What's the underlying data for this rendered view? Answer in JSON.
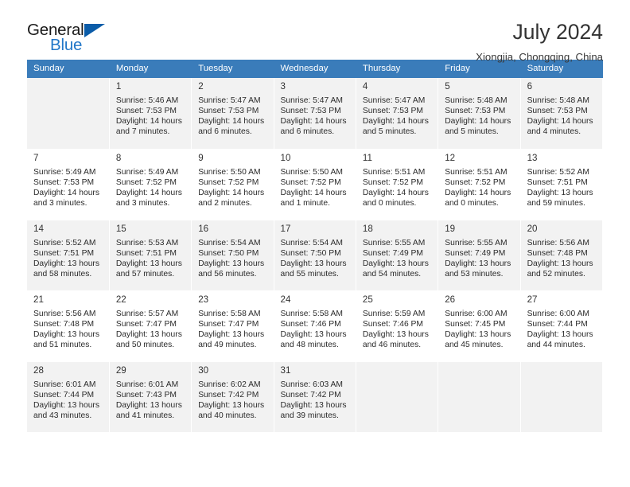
{
  "brand": {
    "name_dark": "General",
    "name_blue": "Blue",
    "accent_color": "#2277c8",
    "triangle_color": "#0b5ca8"
  },
  "header": {
    "title": "July 2024",
    "subtitle": "Xiongjia, Chongqing, China",
    "header_bg_color": "#3a7cba"
  },
  "labels": {
    "sunrise_prefix": "Sunrise:",
    "sunset_prefix": "Sunset:",
    "daylight_prefix": "Daylight:"
  },
  "weekdays": [
    "Sunday",
    "Monday",
    "Tuesday",
    "Wednesday",
    "Thursday",
    "Friday",
    "Saturday"
  ],
  "weeks": [
    [
      {
        "day": ""
      },
      {
        "day": "1",
        "sunrise": "Sunrise: 5:46 AM",
        "sunset": "Sunset: 7:53 PM",
        "daylight_line1": "Daylight: 14 hours",
        "daylight_line2": "and 7 minutes."
      },
      {
        "day": "2",
        "sunrise": "Sunrise: 5:47 AM",
        "sunset": "Sunset: 7:53 PM",
        "daylight_line1": "Daylight: 14 hours",
        "daylight_line2": "and 6 minutes."
      },
      {
        "day": "3",
        "sunrise": "Sunrise: 5:47 AM",
        "sunset": "Sunset: 7:53 PM",
        "daylight_line1": "Daylight: 14 hours",
        "daylight_line2": "and 6 minutes."
      },
      {
        "day": "4",
        "sunrise": "Sunrise: 5:47 AM",
        "sunset": "Sunset: 7:53 PM",
        "daylight_line1": "Daylight: 14 hours",
        "daylight_line2": "and 5 minutes."
      },
      {
        "day": "5",
        "sunrise": "Sunrise: 5:48 AM",
        "sunset": "Sunset: 7:53 PM",
        "daylight_line1": "Daylight: 14 hours",
        "daylight_line2": "and 5 minutes."
      },
      {
        "day": "6",
        "sunrise": "Sunrise: 5:48 AM",
        "sunset": "Sunset: 7:53 PM",
        "daylight_line1": "Daylight: 14 hours",
        "daylight_line2": "and 4 minutes."
      }
    ],
    [
      {
        "day": "7",
        "sunrise": "Sunrise: 5:49 AM",
        "sunset": "Sunset: 7:53 PM",
        "daylight_line1": "Daylight: 14 hours",
        "daylight_line2": "and 3 minutes."
      },
      {
        "day": "8",
        "sunrise": "Sunrise: 5:49 AM",
        "sunset": "Sunset: 7:52 PM",
        "daylight_line1": "Daylight: 14 hours",
        "daylight_line2": "and 3 minutes."
      },
      {
        "day": "9",
        "sunrise": "Sunrise: 5:50 AM",
        "sunset": "Sunset: 7:52 PM",
        "daylight_line1": "Daylight: 14 hours",
        "daylight_line2": "and 2 minutes."
      },
      {
        "day": "10",
        "sunrise": "Sunrise: 5:50 AM",
        "sunset": "Sunset: 7:52 PM",
        "daylight_line1": "Daylight: 14 hours",
        "daylight_line2": "and 1 minute."
      },
      {
        "day": "11",
        "sunrise": "Sunrise: 5:51 AM",
        "sunset": "Sunset: 7:52 PM",
        "daylight_line1": "Daylight: 14 hours",
        "daylight_line2": "and 0 minutes."
      },
      {
        "day": "12",
        "sunrise": "Sunrise: 5:51 AM",
        "sunset": "Sunset: 7:52 PM",
        "daylight_line1": "Daylight: 14 hours",
        "daylight_line2": "and 0 minutes."
      },
      {
        "day": "13",
        "sunrise": "Sunrise: 5:52 AM",
        "sunset": "Sunset: 7:51 PM",
        "daylight_line1": "Daylight: 13 hours",
        "daylight_line2": "and 59 minutes."
      }
    ],
    [
      {
        "day": "14",
        "sunrise": "Sunrise: 5:52 AM",
        "sunset": "Sunset: 7:51 PM",
        "daylight_line1": "Daylight: 13 hours",
        "daylight_line2": "and 58 minutes."
      },
      {
        "day": "15",
        "sunrise": "Sunrise: 5:53 AM",
        "sunset": "Sunset: 7:51 PM",
        "daylight_line1": "Daylight: 13 hours",
        "daylight_line2": "and 57 minutes."
      },
      {
        "day": "16",
        "sunrise": "Sunrise: 5:54 AM",
        "sunset": "Sunset: 7:50 PM",
        "daylight_line1": "Daylight: 13 hours",
        "daylight_line2": "and 56 minutes."
      },
      {
        "day": "17",
        "sunrise": "Sunrise: 5:54 AM",
        "sunset": "Sunset: 7:50 PM",
        "daylight_line1": "Daylight: 13 hours",
        "daylight_line2": "and 55 minutes."
      },
      {
        "day": "18",
        "sunrise": "Sunrise: 5:55 AM",
        "sunset": "Sunset: 7:49 PM",
        "daylight_line1": "Daylight: 13 hours",
        "daylight_line2": "and 54 minutes."
      },
      {
        "day": "19",
        "sunrise": "Sunrise: 5:55 AM",
        "sunset": "Sunset: 7:49 PM",
        "daylight_line1": "Daylight: 13 hours",
        "daylight_line2": "and 53 minutes."
      },
      {
        "day": "20",
        "sunrise": "Sunrise: 5:56 AM",
        "sunset": "Sunset: 7:48 PM",
        "daylight_line1": "Daylight: 13 hours",
        "daylight_line2": "and 52 minutes."
      }
    ],
    [
      {
        "day": "21",
        "sunrise": "Sunrise: 5:56 AM",
        "sunset": "Sunset: 7:48 PM",
        "daylight_line1": "Daylight: 13 hours",
        "daylight_line2": "and 51 minutes."
      },
      {
        "day": "22",
        "sunrise": "Sunrise: 5:57 AM",
        "sunset": "Sunset: 7:47 PM",
        "daylight_line1": "Daylight: 13 hours",
        "daylight_line2": "and 50 minutes."
      },
      {
        "day": "23",
        "sunrise": "Sunrise: 5:58 AM",
        "sunset": "Sunset: 7:47 PM",
        "daylight_line1": "Daylight: 13 hours",
        "daylight_line2": "and 49 minutes."
      },
      {
        "day": "24",
        "sunrise": "Sunrise: 5:58 AM",
        "sunset": "Sunset: 7:46 PM",
        "daylight_line1": "Daylight: 13 hours",
        "daylight_line2": "and 48 minutes."
      },
      {
        "day": "25",
        "sunrise": "Sunrise: 5:59 AM",
        "sunset": "Sunset: 7:46 PM",
        "daylight_line1": "Daylight: 13 hours",
        "daylight_line2": "and 46 minutes."
      },
      {
        "day": "26",
        "sunrise": "Sunrise: 6:00 AM",
        "sunset": "Sunset: 7:45 PM",
        "daylight_line1": "Daylight: 13 hours",
        "daylight_line2": "and 45 minutes."
      },
      {
        "day": "27",
        "sunrise": "Sunrise: 6:00 AM",
        "sunset": "Sunset: 7:44 PM",
        "daylight_line1": "Daylight: 13 hours",
        "daylight_line2": "and 44 minutes."
      }
    ],
    [
      {
        "day": "28",
        "sunrise": "Sunrise: 6:01 AM",
        "sunset": "Sunset: 7:44 PM",
        "daylight_line1": "Daylight: 13 hours",
        "daylight_line2": "and 43 minutes."
      },
      {
        "day": "29",
        "sunrise": "Sunrise: 6:01 AM",
        "sunset": "Sunset: 7:43 PM",
        "daylight_line1": "Daylight: 13 hours",
        "daylight_line2": "and 41 minutes."
      },
      {
        "day": "30",
        "sunrise": "Sunrise: 6:02 AM",
        "sunset": "Sunset: 7:42 PM",
        "daylight_line1": "Daylight: 13 hours",
        "daylight_line2": "and 40 minutes."
      },
      {
        "day": "31",
        "sunrise": "Sunrise: 6:03 AM",
        "sunset": "Sunset: 7:42 PM",
        "daylight_line1": "Daylight: 13 hours",
        "daylight_line2": "and 39 minutes."
      },
      {
        "day": ""
      },
      {
        "day": ""
      },
      {
        "day": ""
      }
    ]
  ]
}
